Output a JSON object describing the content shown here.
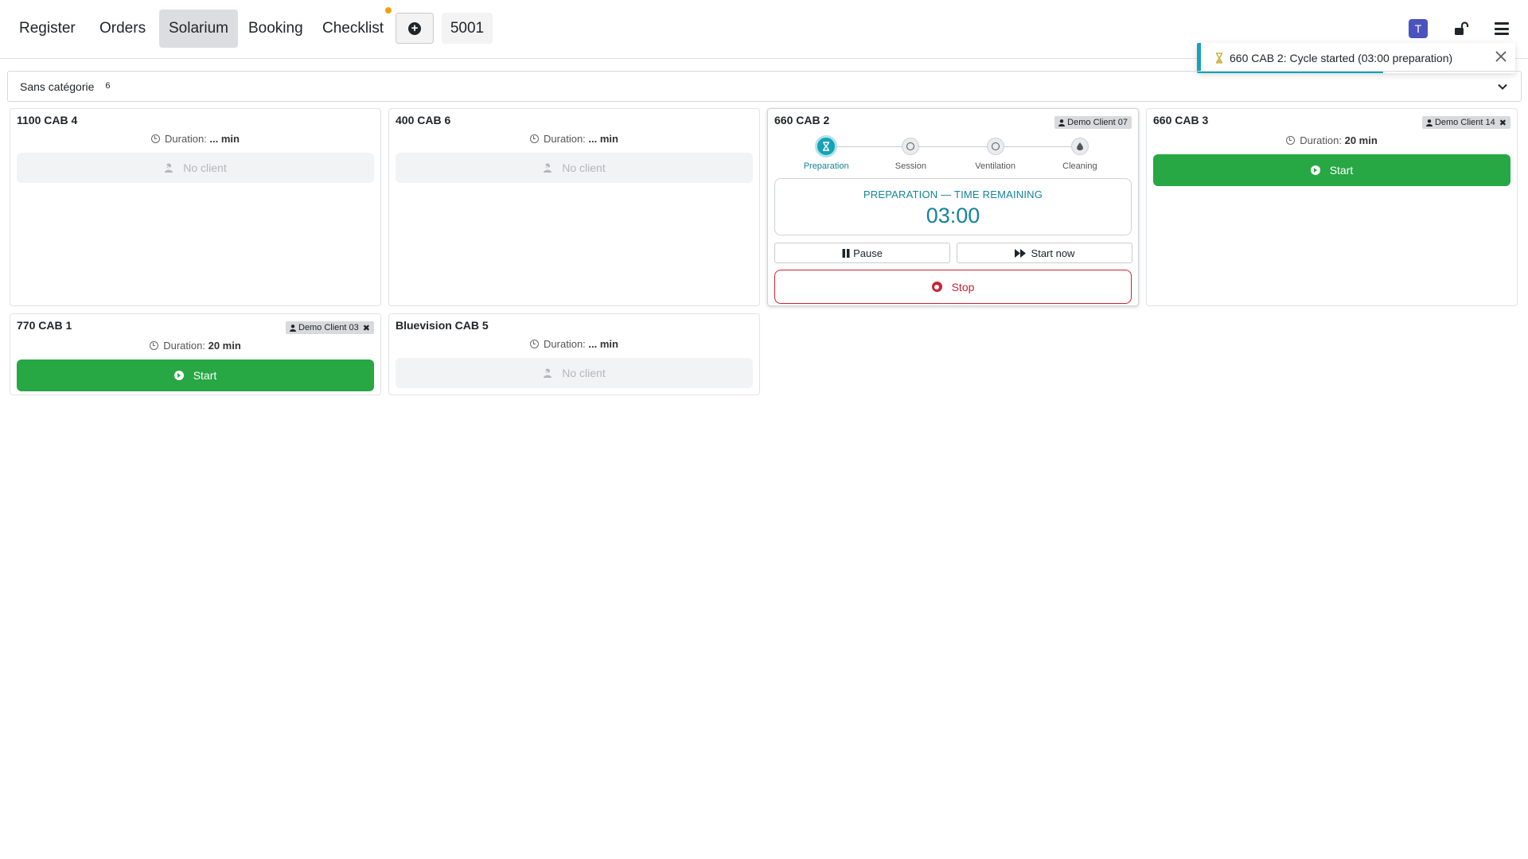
{
  "nav": {
    "tabs": [
      {
        "label": "Register"
      },
      {
        "label": "Orders"
      },
      {
        "label": "Solarium",
        "active": true
      },
      {
        "label": "Booking"
      },
      {
        "label": "Checklist"
      }
    ],
    "register_number": "5001",
    "user_initial": "T"
  },
  "category": {
    "name": "Sans catégorie",
    "count": "6"
  },
  "toast": {
    "message": "660 CAB 2: Cycle started (03:00 preparation)",
    "progress_fraction": 0.58
  },
  "common": {
    "duration_label": "Duration:",
    "no_client_label": "No client",
    "start_label": "Start"
  },
  "cabins": [
    {
      "name": "1100 CAB 4",
      "duration": "... min",
      "client": null,
      "state": "idle"
    },
    {
      "name": "400 CAB 6",
      "duration": "... min",
      "client": null,
      "state": "idle"
    },
    {
      "name": "660 CAB 2",
      "client": "Demo Client 07",
      "state": "running",
      "steps": [
        "Preparation",
        "Session",
        "Ventilation",
        "Cleaning"
      ],
      "current_step": 0,
      "timer_label": "PREPARATION — TIME REMAINING",
      "timer_value": "03:00",
      "pause_label": "Pause",
      "start_now_label": "Start now",
      "stop_label": "Stop"
    },
    {
      "name": "660 CAB 3",
      "duration": "20 min",
      "client": "Demo Client 14",
      "state": "ready"
    },
    {
      "name": "770 CAB 1",
      "duration": "20 min",
      "client": "Demo Client 03",
      "state": "ready"
    },
    {
      "name": "Bluevision CAB 5",
      "duration": "... min",
      "client": null,
      "state": "idle"
    }
  ],
  "colors": {
    "accent": "#17a2b8",
    "start": "#28a745",
    "stop": "#c82333",
    "avatar": "#4b53bc"
  }
}
